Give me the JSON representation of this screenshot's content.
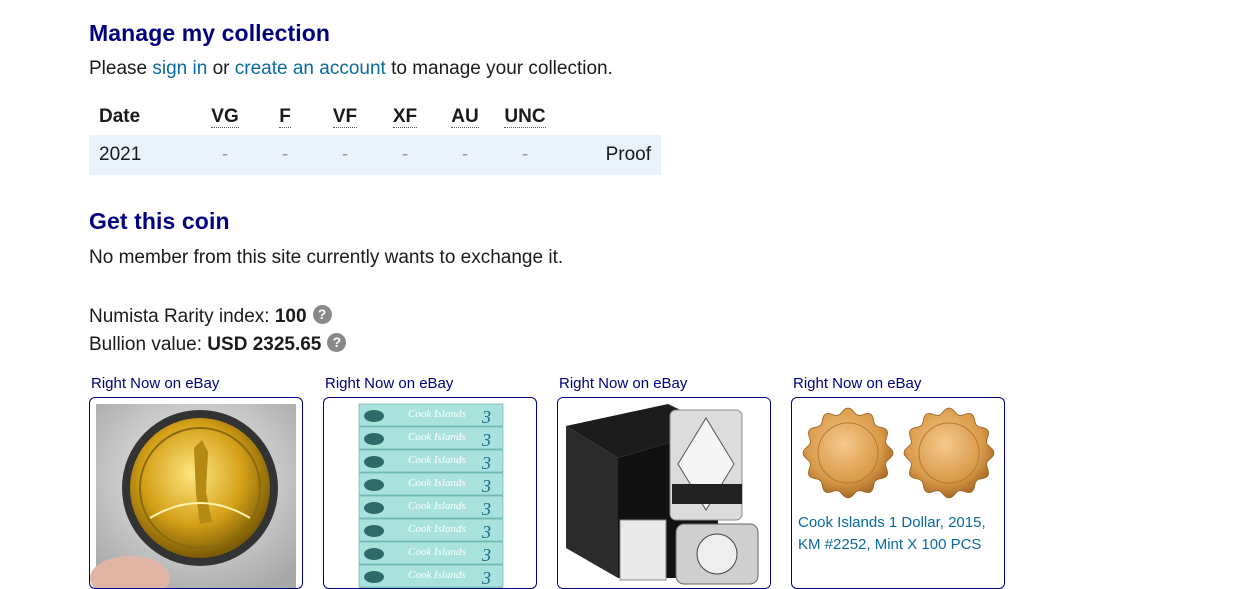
{
  "manage": {
    "title": "Manage my collection",
    "text_before": "Please ",
    "signin_link": "sign in",
    "text_or": " or ",
    "create_link": "create an account",
    "text_after": " to manage your collection."
  },
  "grades_table": {
    "headers": [
      "Date",
      "VG",
      "F",
      "VF",
      "XF",
      "AU",
      "UNC"
    ],
    "row": {
      "date": "2021",
      "values": [
        "-",
        "-",
        "-",
        "-",
        "-",
        "-"
      ],
      "extra": "Proof"
    }
  },
  "get_coin": {
    "title": "Get this coin",
    "text": "No member from this site currently wants to exchange it."
  },
  "rarity": {
    "label": "Numista Rarity index: ",
    "value": "100"
  },
  "bullion": {
    "label": "Bullion value: ",
    "value": "USD 2325.65"
  },
  "ebay_items": [
    {
      "label": "Right Now on eBay",
      "caption": ""
    },
    {
      "label": "Right Now on eBay",
      "caption": ""
    },
    {
      "label": "Right Now on eBay",
      "caption": ""
    },
    {
      "label": "Right Now on eBay",
      "caption": "Cook Islands 1 Dollar, 2015, KM #2252, Mint X 100 PCS"
    }
  ],
  "banknote_text": "Cook Islands",
  "banknote_value": "3",
  "icons": {
    "help": "question-circle-icon"
  }
}
